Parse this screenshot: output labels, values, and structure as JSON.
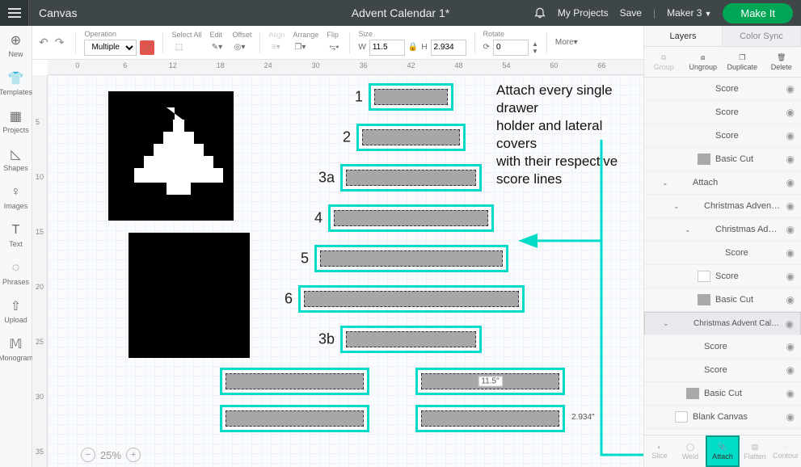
{
  "header": {
    "canvas_label": "Canvas",
    "project_title": "Advent Calendar 1*",
    "my_projects": "My Projects",
    "save": "Save",
    "machine": "Maker 3",
    "make_it": "Make It"
  },
  "rail": {
    "new": "New",
    "templates": "Templates",
    "projects": "Projects",
    "shapes": "Shapes",
    "images": "Images",
    "text": "Text",
    "phrases": "Phrases",
    "upload": "Upload",
    "monogram": "Monogram"
  },
  "toolbar": {
    "operation_label": "Operation",
    "operation_value": "Multiple",
    "select_all": "Select All",
    "edit": "Edit",
    "offset": "Offset",
    "align": "Align",
    "arrange": "Arrange",
    "flip": "Flip",
    "size": "Size",
    "w": "W",
    "w_val": "11.5",
    "h": "H",
    "h_val": "2.934",
    "rotate": "Rotate",
    "rotate_val": "0",
    "more": "More"
  },
  "ruler_ticks_h": [
    "0",
    "6",
    "12",
    "18",
    "24",
    "30",
    "36",
    "42",
    "48",
    "54",
    "60",
    "66"
  ],
  "ruler_ticks_v": [
    "5",
    "10",
    "15",
    "20",
    "25",
    "30",
    "35"
  ],
  "pieces": {
    "t1": "1",
    "t2": "2",
    "t3a": "3a",
    "t4": "4",
    "t5": "5",
    "t6": "6",
    "t3b": "3b"
  },
  "dims": {
    "w_badge": "11.5\"",
    "h_badge": "2.934\""
  },
  "annotation": {
    "l1": "Attach every single drawer",
    "l2": "holder and lateral covers",
    "l3": " with their respective score lines"
  },
  "zoom": {
    "pct": "25%"
  },
  "right": {
    "tabs": {
      "layers": "Layers",
      "color_sync": "Color Sync"
    },
    "actions": {
      "group": "Group",
      "ungroup": "Ungroup",
      "duplicate": "Duplicate",
      "delete": "Delete"
    },
    "layers": [
      {
        "indent": 3,
        "name": "Score",
        "sw": false
      },
      {
        "indent": 3,
        "name": "Score",
        "sw": false
      },
      {
        "indent": 3,
        "name": "Score",
        "sw": false
      },
      {
        "indent": 3,
        "name": "Basic Cut",
        "sw": true
      },
      {
        "indent": 1,
        "name": "Attach",
        "exp": true
      },
      {
        "indent": 2,
        "name": "Christmas Advent C...",
        "exp": true
      },
      {
        "indent": 3,
        "name": "Christmas Advent...",
        "exp": true
      },
      {
        "indent": 4,
        "name": "Score",
        "sw": false
      },
      {
        "indent": 3,
        "name": "Score",
        "sw": true,
        "swblank": true
      },
      {
        "indent": 3,
        "name": "Basic Cut",
        "sw": true
      },
      {
        "indent": 1,
        "name": "Christmas Advent Cale...",
        "exp": true,
        "sel": true
      },
      {
        "indent": 2,
        "name": "Score",
        "sw": false
      },
      {
        "indent": 2,
        "name": "Score",
        "sw": false
      },
      {
        "indent": 2,
        "name": "Basic Cut",
        "sw": true
      },
      {
        "indent": 1,
        "name": "Blank Canvas",
        "sw": true,
        "swblank": true
      }
    ],
    "bottom": {
      "slice": "Slice",
      "weld": "Weld",
      "attach": "Attach",
      "flatten": "Flatten",
      "contour": "Contour"
    }
  }
}
